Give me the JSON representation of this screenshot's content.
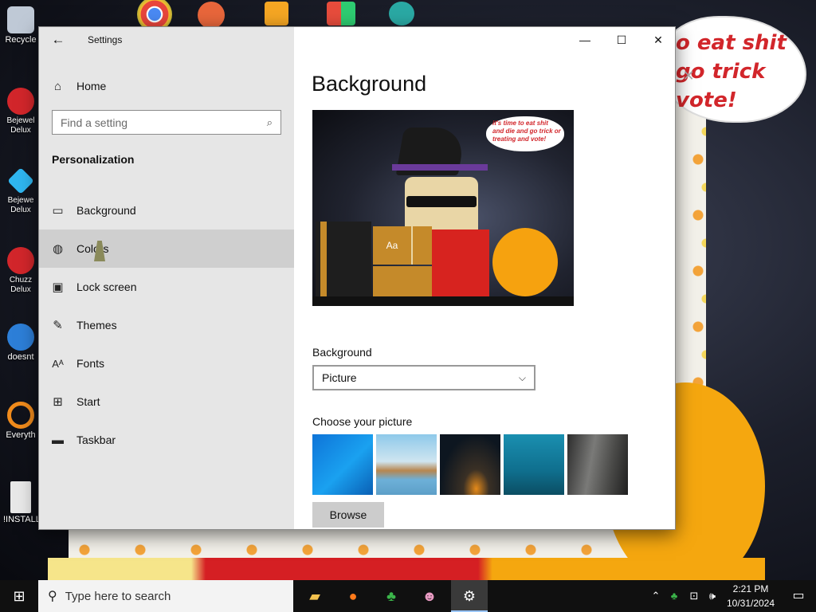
{
  "desktop": {
    "icons": [
      {
        "label": "Recycle",
        "color": "#bfc9d6"
      },
      {
        "label": "Bejewel Delux",
        "color": "#d2262b"
      },
      {
        "label": "Bejewe Delux",
        "color": "#2fb6f0"
      },
      {
        "label": "Chuzz Delux",
        "color": "#d2262b"
      },
      {
        "label": "doesnt",
        "color": "#2d7fd8"
      },
      {
        "label": "Everyth",
        "color": "#f08b1c"
      },
      {
        "label": "!INSTALL",
        "color": "#e8e8e8"
      }
    ],
    "wallpaper_text": "o eat shit\ngo trick\nvote!"
  },
  "settings": {
    "title": "Settings",
    "home_label": "Home",
    "search_placeholder": "Find a setting",
    "section": "Personalization",
    "nav_items": [
      {
        "label": "Background",
        "icon": "picture-icon"
      },
      {
        "label": "Colors",
        "icon": "palette-icon"
      },
      {
        "label": "Lock screen",
        "icon": "lock-screen-icon"
      },
      {
        "label": "Themes",
        "icon": "themes-icon"
      },
      {
        "label": "Fonts",
        "icon": "fonts-icon"
      },
      {
        "label": "Start",
        "icon": "start-icon"
      },
      {
        "label": "Taskbar",
        "icon": "taskbar-icon"
      }
    ],
    "hovered_item": "Colors",
    "page_title": "Background",
    "preview": {
      "bubble_text": "it's time to eat shit and die and go trick or treating and vote!",
      "tile_label": "Aa"
    },
    "background_label": "Background",
    "background_value": "Picture",
    "choose_picture_label": "Choose your picture",
    "browse_label": "Browse"
  },
  "taskbar": {
    "search_placeholder": "Type here to search",
    "time": "2:21 PM",
    "date": "10/31/2024"
  }
}
